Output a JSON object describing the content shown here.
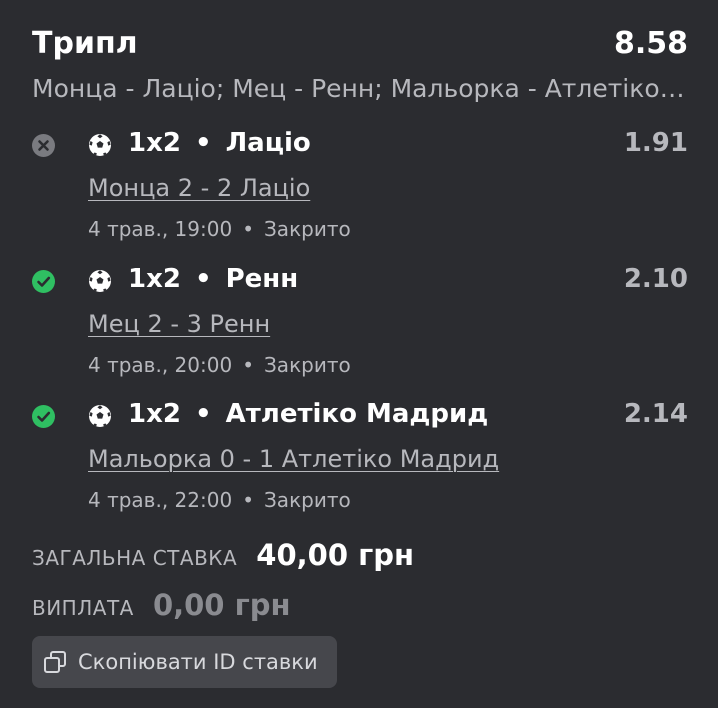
{
  "bet": {
    "type": "Трипл",
    "total_odds": "8.58",
    "summary": "Монца - Лаціо; Мец - Ренн; Мальорка - Атлетіко Мадрид"
  },
  "legs": [
    {
      "status": "lost",
      "status_icon": "x-circle-icon",
      "market": "1x2",
      "separator": "•",
      "selection": "Лаціо",
      "odds": "1.91",
      "match": "Монца 2 - 2 Лаціо",
      "datetime": "4 трав., 19:00",
      "meta_separator": "•",
      "state": "Закрито"
    },
    {
      "status": "won",
      "status_icon": "check-circle-icon",
      "market": "1x2",
      "separator": "•",
      "selection": "Ренн",
      "odds": "2.10",
      "match": "Мец 2 - 3 Ренн",
      "datetime": "4 трав., 20:00",
      "meta_separator": "•",
      "state": "Закрито"
    },
    {
      "status": "won",
      "status_icon": "check-circle-icon",
      "market": "1x2",
      "separator": "•",
      "selection": "Атлетіко Мадрид",
      "odds": "2.14",
      "match": "Мальорка 0 - 1 Атлетіко Мадрид",
      "datetime": "4 трав., 22:00",
      "meta_separator": "•",
      "state": "Закрито"
    }
  ],
  "stake": {
    "label": "ЗАГАЛЬНА СТАВКА",
    "value": "40,00 грн"
  },
  "payout": {
    "label": "ВИПЛАТА",
    "value": "0,00 грн"
  },
  "copy_button": {
    "label": "Скопіювати ID ставки",
    "icon": "copy-icon"
  },
  "colors": {
    "background": "#2b2c30",
    "won": "#2fbf62",
    "lost": "#7a7b80",
    "muted_text": "#b7b8bd",
    "button_bg": "#46474c"
  }
}
